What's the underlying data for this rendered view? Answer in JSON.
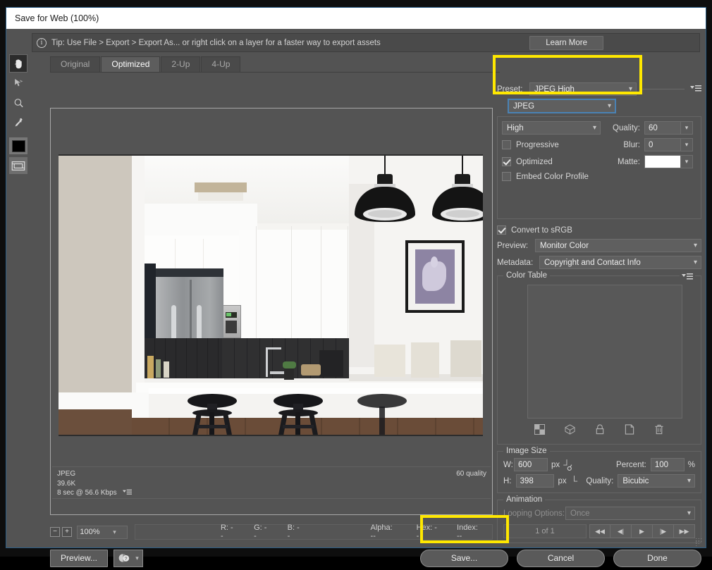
{
  "window": {
    "title": "Save for Web (100%)"
  },
  "tip": {
    "text": "Tip: Use File > Export > Export As...  or right click on a layer for a faster way to export assets",
    "learn_more": "Learn More",
    "info_icon": "info-icon"
  },
  "toolbox": [
    {
      "name": "hand-tool",
      "glyph": "✋",
      "active": true
    },
    {
      "name": "slice-select-tool",
      "glyph": "➤",
      "active": false
    },
    {
      "name": "zoom-tool",
      "glyph": "⌕",
      "active": false
    },
    {
      "name": "eyedropper-tool",
      "glyph": "✒",
      "active": false
    }
  ],
  "tabs": [
    {
      "label": "Original",
      "active": false
    },
    {
      "label": "Optimized",
      "active": true
    },
    {
      "label": "2-Up",
      "active": false
    },
    {
      "label": "4-Up",
      "active": false
    }
  ],
  "preview": {
    "format": "JPEG",
    "filesize": "39.6K",
    "download_time": "8 sec @ 56.6 Kbps",
    "quality_note": "60 quality"
  },
  "status": {
    "zoom_level": "100%",
    "r": "R: --",
    "g": "G: --",
    "b": "B: --",
    "alpha": "Alpha: --",
    "hex": "Hex: --",
    "index": "Index: --",
    "minus": "−",
    "plus": "+"
  },
  "buttons": {
    "preview": "Preview...",
    "save": "Save...",
    "cancel": "Cancel",
    "done": "Done"
  },
  "settings": {
    "preset_label": "Preset:",
    "preset_value": "JPEG High",
    "format_value": "JPEG",
    "compression_value": "High",
    "quality_label": "Quality:",
    "quality_value": "60",
    "blur_label": "Blur:",
    "blur_value": "0",
    "matte_label": "Matte:",
    "matte_color": "#ffffff",
    "progressive_label": "Progressive",
    "progressive_checked": false,
    "optimized_label": "Optimized",
    "optimized_checked": true,
    "embed_profile_label": "Embed Color Profile",
    "embed_profile_checked": false,
    "convert_srgb_label": "Convert to sRGB",
    "convert_srgb_checked": true,
    "preview_label": "Preview:",
    "preview_value": "Monitor Color",
    "metadata_label": "Metadata:",
    "metadata_value": "Copyright and Contact Info"
  },
  "color_table": {
    "legend": "Color Table",
    "icons": [
      "snap-to-web-palette-icon",
      "web-shift-icon",
      "lock-color-icon",
      "new-color-icon",
      "delete-color-icon"
    ]
  },
  "image_size": {
    "legend": "Image Size",
    "w_label": "W:",
    "w_value": "600",
    "h_label": "H:",
    "h_value": "398",
    "unit": "px",
    "percent_label": "Percent:",
    "percent_value": "100",
    "percent_unit": "%",
    "quality_label": "Quality:",
    "quality_value": "Bicubic",
    "link_icon": "chain-link-icon"
  },
  "animation": {
    "legend": "Animation",
    "looping_label": "Looping Options:",
    "looping_value": "Once",
    "frame_counter": "1 of 1",
    "controls": [
      "first-frame-icon",
      "previous-frame-icon",
      "play-icon",
      "next-frame-icon",
      "last-frame-icon"
    ]
  },
  "colors": {
    "highlight": "#ffe800",
    "panel_bg": "#535353",
    "accent_focus": "#4a82b4"
  }
}
